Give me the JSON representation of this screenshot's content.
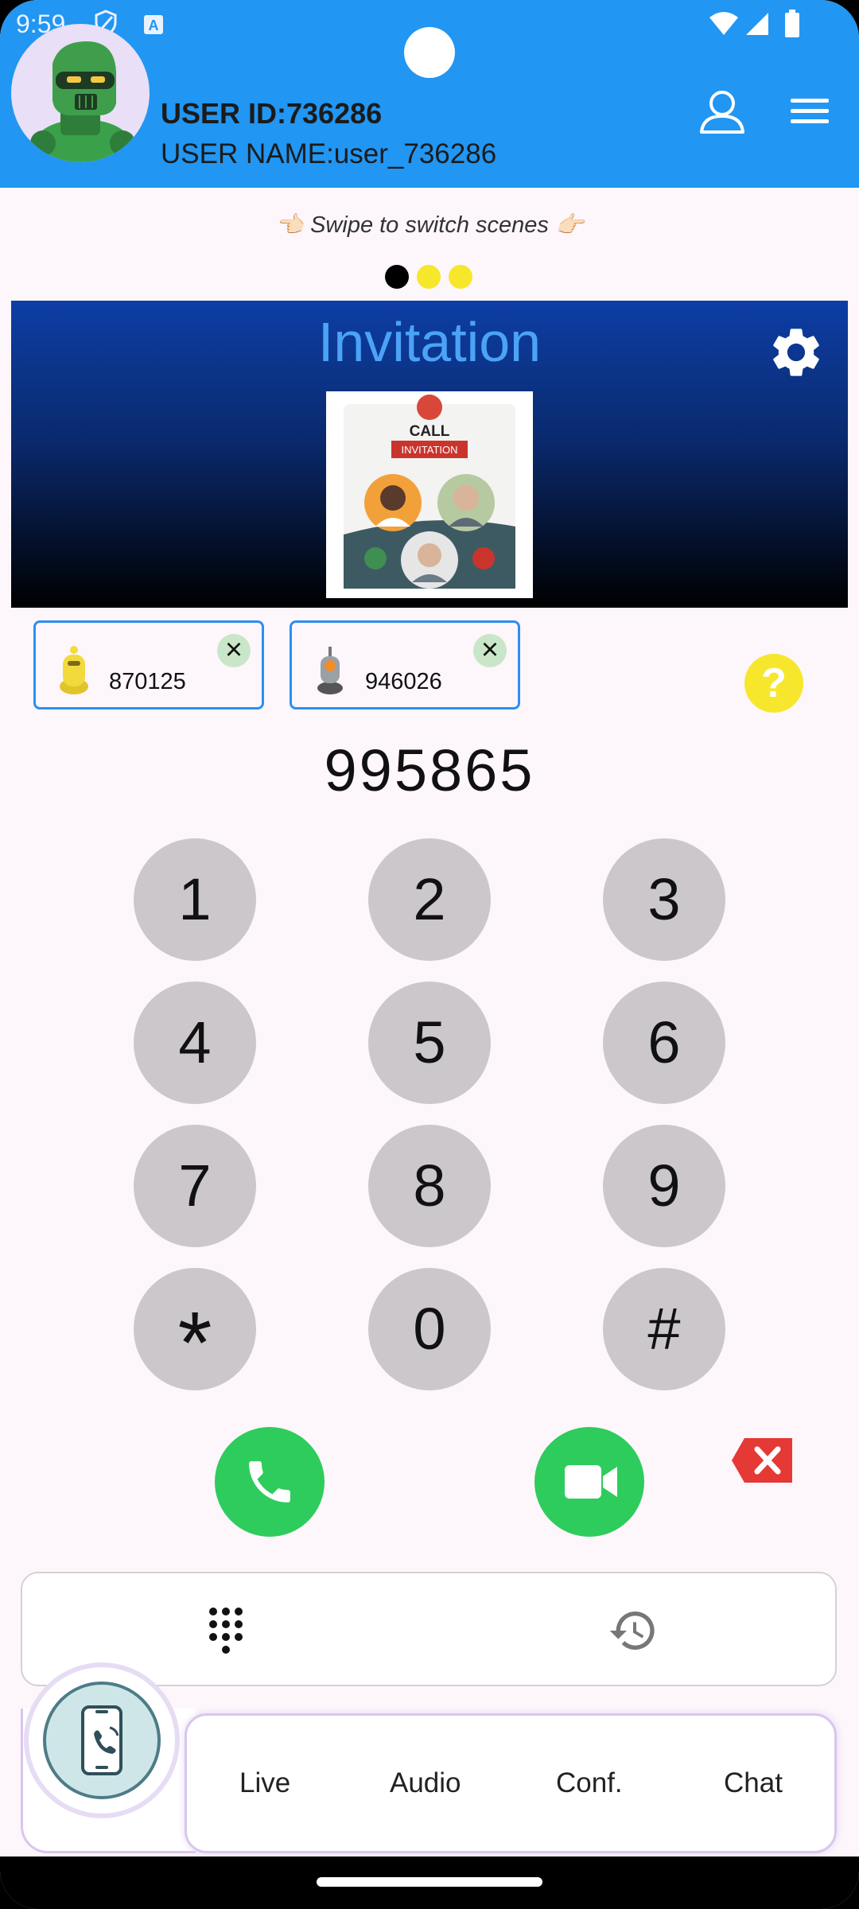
{
  "status_bar": {
    "time": "9:59"
  },
  "header": {
    "user_id": "USER ID:736286",
    "user_name": "USER NAME:user_736286"
  },
  "swipe_hint": "👈🏻 Swipe to switch scenes 👉🏻",
  "scene_dots": [
    {
      "color": "#000000",
      "active": true
    },
    {
      "color": "#f6e72c",
      "active": false
    },
    {
      "color": "#f6e72c",
      "active": false
    }
  ],
  "banner": {
    "title": "Invitation",
    "card_top": "CALL",
    "card_tag": "INVITATION"
  },
  "invitees": [
    {
      "id": "870125",
      "avatar": "yellow-robot"
    },
    {
      "id": "946026",
      "avatar": "grey-robot"
    }
  ],
  "dialed_number": "995865",
  "keypad": [
    "1",
    "2",
    "3",
    "4",
    "5",
    "6",
    "7",
    "8",
    "9",
    "*",
    "0",
    "#"
  ],
  "mode_tabs": [
    {
      "name": "dialpad-icon"
    },
    {
      "name": "history-icon"
    }
  ],
  "nav": {
    "items": [
      "Live",
      "Audio",
      "Conf.",
      "Chat"
    ]
  },
  "colors": {
    "header": "#2196f3",
    "call_green": "#2ecc5c",
    "backspace_red": "#e53935",
    "help_yellow": "#f6e72c",
    "key_grey": "#ccc7cb"
  }
}
